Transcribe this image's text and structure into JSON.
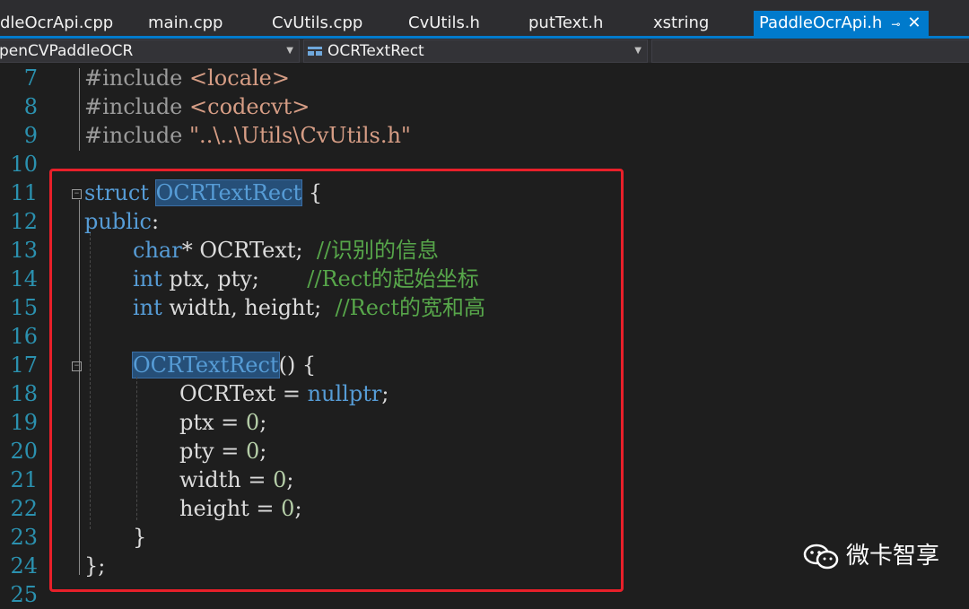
{
  "tabs": [
    {
      "label": "dleOcrApi.cpp"
    },
    {
      "label": "main.cpp"
    },
    {
      "label": "CvUtils.cpp"
    },
    {
      "label": "CvUtils.h"
    },
    {
      "label": "putText.h"
    },
    {
      "label": "xstring"
    },
    {
      "label": "PaddleOcrApi.h",
      "active": true
    }
  ],
  "tab_icons": {
    "pin": "pin-icon",
    "close": "close-icon"
  },
  "nav": {
    "project": "penCVPaddleOCR",
    "scope": "OCRTextRect",
    "scope_icon": "struct-icon",
    "member": ""
  },
  "editor": {
    "lines": [
      {
        "n": "7"
      },
      {
        "n": "8"
      },
      {
        "n": "9"
      },
      {
        "n": "10"
      },
      {
        "n": "11"
      },
      {
        "n": "12"
      },
      {
        "n": "13"
      },
      {
        "n": "14"
      },
      {
        "n": "15"
      },
      {
        "n": "16"
      },
      {
        "n": "17"
      },
      {
        "n": "18"
      },
      {
        "n": "19"
      },
      {
        "n": "20"
      },
      {
        "n": "21"
      },
      {
        "n": "22"
      },
      {
        "n": "23"
      },
      {
        "n": "24"
      },
      {
        "n": "25"
      }
    ],
    "code": {
      "l7": {
        "pp": "#include",
        "rest": " <locale>"
      },
      "l8": {
        "pp": "#include",
        "rest": " <codecvt>"
      },
      "l9": {
        "pp": "#include",
        "str": " \"..\\..\\Utils\\CvUtils.h\""
      },
      "l11": {
        "kw": "struct",
        "name": "OCRTextRect",
        "rest": " {"
      },
      "l12": {
        "kw": "public",
        "rest": ":"
      },
      "l13": {
        "kw": "char",
        "rest": "* OCRText;  ",
        "cm": "//识别的信息"
      },
      "l14": {
        "kw": "int",
        "rest": " ptx, pty;       ",
        "cm": "//Rect的起始坐标"
      },
      "l15": {
        "kw": "int",
        "rest": " width, height;  ",
        "cm": "//Rect的宽和高"
      },
      "l17": {
        "name": "OCRTextRect",
        "rest": "() {"
      },
      "l18": {
        "rest": "OCRText = ",
        "kw": "nullptr",
        "rest2": ";"
      },
      "l19": {
        "rest": "ptx = ",
        "num": "0",
        "rest2": ";"
      },
      "l20": {
        "rest": "pty = ",
        "num": "0",
        "rest2": ";"
      },
      "l21": {
        "rest": "width = ",
        "num": "0",
        "rest2": ";"
      },
      "l22": {
        "rest": "height = ",
        "num": "0",
        "rest2": ";"
      },
      "l23": {
        "rest": "}"
      },
      "l24": {
        "rest": "};"
      }
    }
  },
  "watermark": {
    "text": "微卡智享",
    "icon": "wechat-icon"
  },
  "colors": {
    "accent": "#007acc",
    "highlight_box": "#e8202a",
    "keyword": "#569cd6",
    "comment": "#57a64a",
    "string": "#d69d85",
    "line_number": "#2b91af"
  }
}
